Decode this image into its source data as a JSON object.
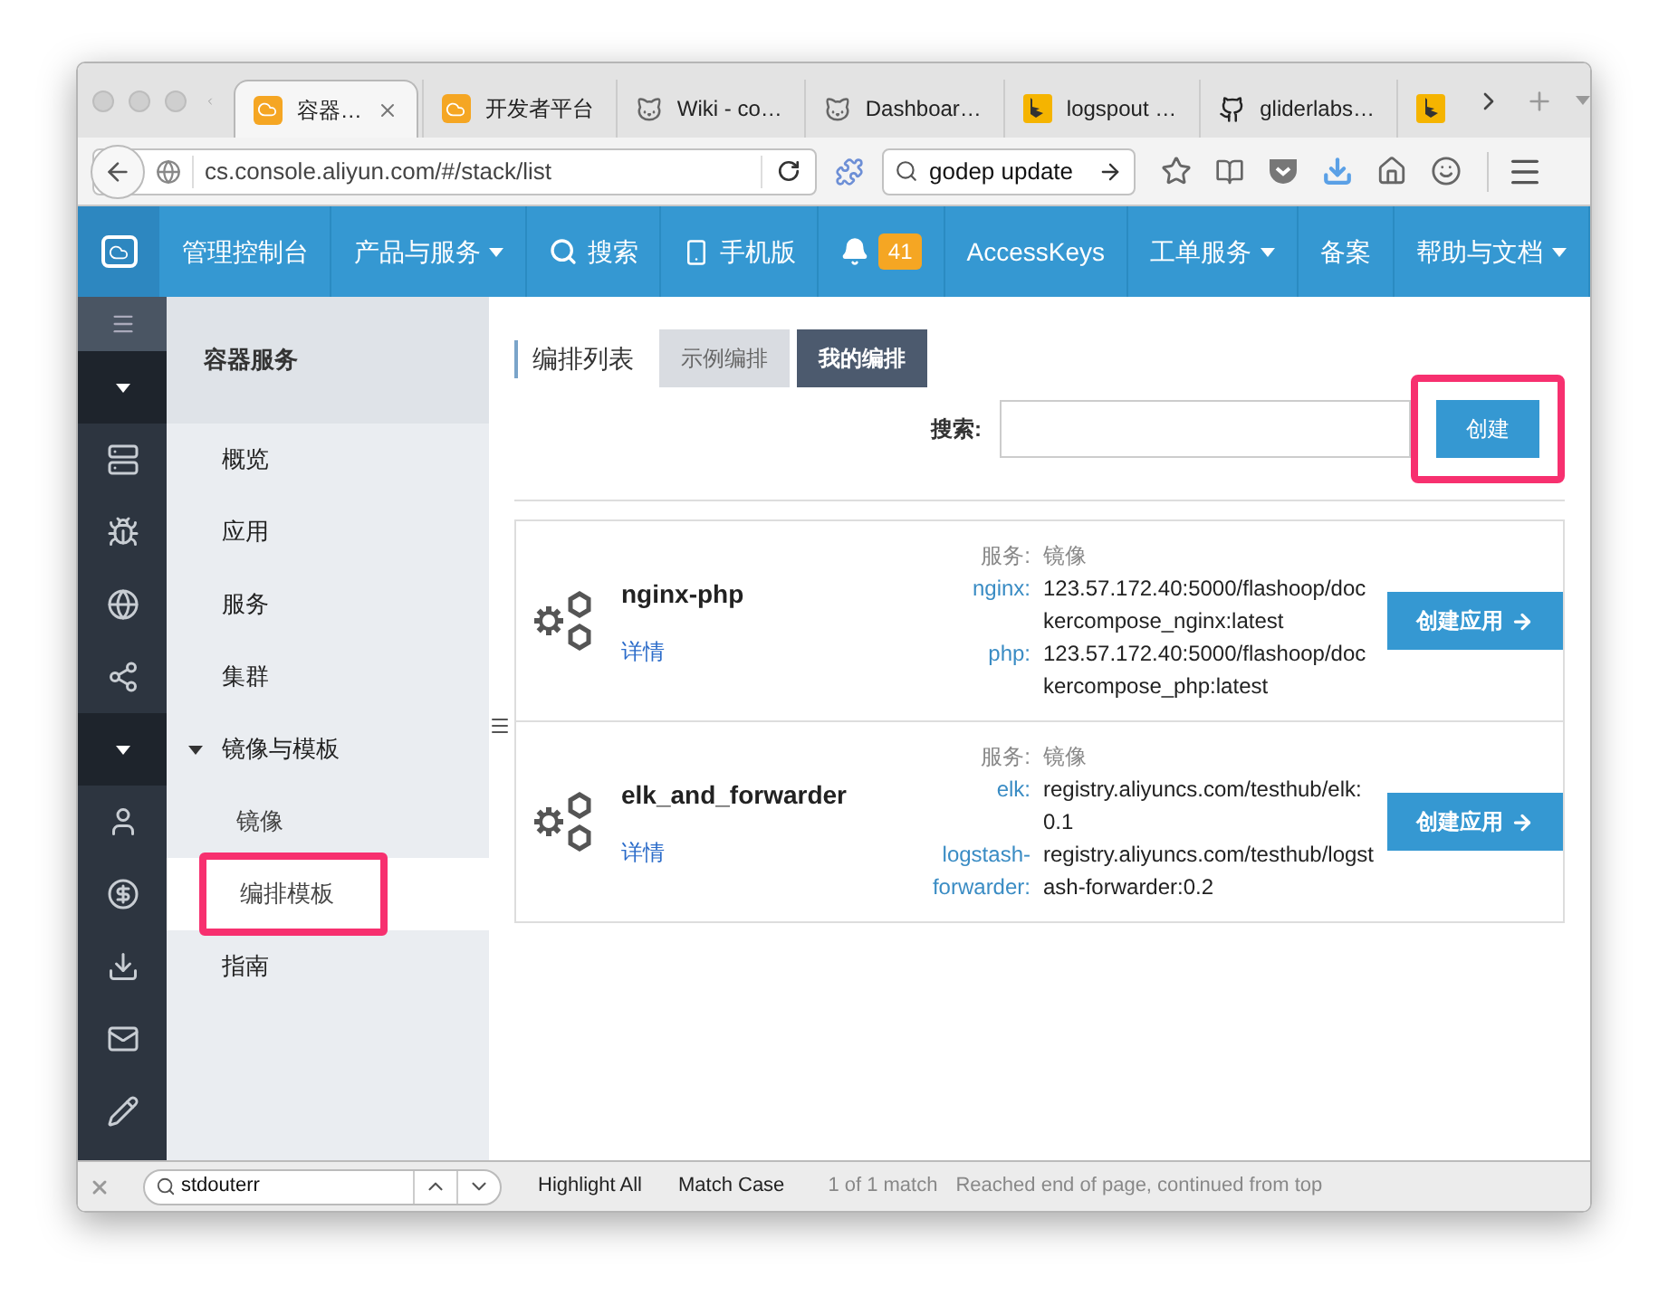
{
  "browser": {
    "tabs": [
      {
        "title": "容器…",
        "kind": "aliyun",
        "selected": true,
        "closable": true
      },
      {
        "title": "开发者平台",
        "kind": "aliyun",
        "selected": false,
        "closable": false
      },
      {
        "title": "Wiki - co…",
        "kind": "fox",
        "selected": false,
        "closable": false
      },
      {
        "title": "Dashboar…",
        "kind": "fox",
        "selected": false,
        "closable": false
      },
      {
        "title": "logspout …",
        "kind": "bing",
        "selected": false,
        "closable": false
      },
      {
        "title": "gliderlabs…",
        "kind": "github",
        "selected": false,
        "closable": false
      },
      {
        "kind": "bing",
        "selected": false,
        "closable": false
      }
    ],
    "url": "cs.console.aliyun.com/#/stack/list",
    "search": "godep update"
  },
  "header": {
    "items": [
      {
        "label": "管理控制台",
        "kind": "text"
      },
      {
        "label": "产品与服务",
        "kind": "dropdown"
      },
      {
        "label": "搜索",
        "kind": "search"
      },
      {
        "label": "手机版",
        "kind": "phone"
      },
      {
        "label": "41",
        "kind": "bell"
      },
      {
        "label": "AccessKeys",
        "kind": "text"
      },
      {
        "label": "工单服务",
        "kind": "dropdown"
      },
      {
        "label": "备案",
        "kind": "text"
      },
      {
        "label": "帮助与文档",
        "kind": "dropdown"
      }
    ]
  },
  "sidebar": {
    "title": "容器服务",
    "items": [
      {
        "label": "概览",
        "selected": false
      },
      {
        "label": "应用",
        "selected": false
      },
      {
        "label": "服务",
        "selected": false
      },
      {
        "label": "集群",
        "selected": false
      },
      {
        "label": "镜像与模板",
        "selected": false,
        "expanded": true,
        "children": [
          {
            "label": "镜像",
            "selected": false
          },
          {
            "label": "编排模板",
            "selected": true,
            "highlighted": true
          }
        ]
      },
      {
        "label": "指南",
        "selected": false
      }
    ]
  },
  "content": {
    "title": "编排列表",
    "tabs": [
      {
        "label": "示例编排",
        "selected": false
      },
      {
        "label": "我的编排",
        "selected": true
      }
    ],
    "search_label": "搜索:",
    "create_button": {
      "label": "创建",
      "highlighted": true
    },
    "stacks": [
      {
        "name": "nginx-php",
        "details": "详情",
        "services_header": "服务:",
        "images_header": "镜像",
        "services": [
          {
            "name": "nginx:",
            "image": "123.57.172.40:5000/flashoop/dockercompose_nginx:latest"
          },
          {
            "name": "php:",
            "image": "123.57.172.40:5000/flashoop/dockercompose_php:latest"
          }
        ],
        "button": "创建应用"
      },
      {
        "name": "elk_and_forwarder",
        "details": "详情",
        "services_header": "服务:",
        "images_header": "镜像",
        "services": [
          {
            "name": "elk:",
            "image": "registry.aliyuncs.com/testhub/elk:0.1"
          },
          {
            "name": "logstash-forwarder:",
            "image": "registry.aliyuncs.com/testhub/logstash-forwarder:0.2"
          }
        ],
        "button": "创建应用"
      }
    ]
  },
  "find_bar": {
    "value": "stdouterr",
    "highlight_all": "Highlight All",
    "match_case": "Match Case",
    "count": "1 of 1 match",
    "status": "Reached end of page, continued from top"
  }
}
